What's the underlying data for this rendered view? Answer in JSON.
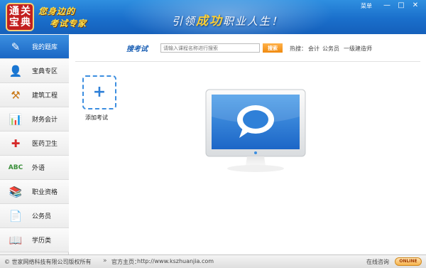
{
  "header": {
    "logo_chars": [
      "通",
      "关",
      "宝",
      "典"
    ],
    "slogan_line1": "您身边的",
    "slogan_line2": "考试专家",
    "banner_pre": "引领",
    "banner_hl": "成功",
    "banner_post": "职业人生！",
    "menu_label": "菜单",
    "min_glyph": "—",
    "max_glyph": "□",
    "close_glyph": "✕"
  },
  "sidebar": {
    "items": [
      {
        "label": "我的题库",
        "icon": "pencil-icon",
        "glyph": "✎",
        "color": "#ffffff",
        "active": true
      },
      {
        "label": "宝典专区",
        "icon": "user-icon",
        "glyph": "👤",
        "color": "#1a7fd8",
        "active": false
      },
      {
        "label": "建筑工程",
        "icon": "tools-icon",
        "glyph": "⚒",
        "color": "#c97a1a",
        "active": false
      },
      {
        "label": "财务会计",
        "icon": "chart-icon",
        "glyph": "📊",
        "color": "#2f9e3a",
        "active": false
      },
      {
        "label": "医药卫生",
        "icon": "medical-cross-icon",
        "glyph": "✚",
        "color": "#d62a2a",
        "active": false
      },
      {
        "label": "外语",
        "icon": "abc-icon",
        "glyph": "ABC",
        "color": "#3a8f3a",
        "active": false
      },
      {
        "label": "职业资格",
        "icon": "books-icon",
        "glyph": "📚",
        "color": "#555555",
        "active": false
      },
      {
        "label": "公务员",
        "icon": "document-icon",
        "glyph": "📄",
        "color": "#7aa83a",
        "active": false
      },
      {
        "label": "学历类",
        "icon": "book-icon",
        "glyph": "📖",
        "color": "#333333",
        "active": false
      }
    ]
  },
  "search": {
    "title": "搜考试",
    "placeholder": "请输入课程名称进行搜索",
    "button": "搜索",
    "hot_label": "热搜：",
    "hot_links": [
      "会计",
      "公务员",
      "一级建造师"
    ]
  },
  "main": {
    "add_exam_label": "添加考试",
    "add_glyph": "+"
  },
  "footer": {
    "copyright": "© 世家网络科技有限公司版权所有",
    "homepage_arrow": "»",
    "homepage_label": "官方主页：",
    "homepage_url": "http://www.kszhuanjia.com",
    "online_text": "在线咨询",
    "online_badge": "ONLINE"
  }
}
